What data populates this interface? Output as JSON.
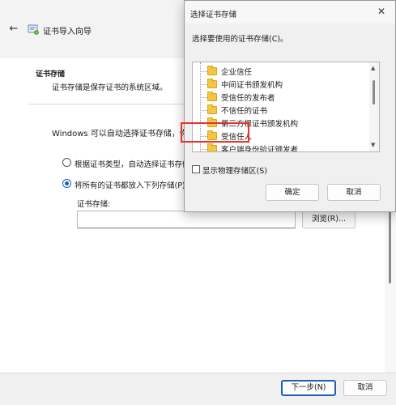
{
  "wizard": {
    "title": "证书导入向导",
    "back_icon": "back-arrow-icon",
    "app_icon": "certificate-icon",
    "heading": "证书存储",
    "description": "证书存储是保存证书的系统区域。",
    "auto_text": "Windows 可以自动选择证书存储，你也",
    "option_auto_label": "根据证书类型，自动选择证书存储",
    "option_manual_label": "将所有的证书都放入下列存储(P)",
    "store_label": "证书存储:",
    "store_value": "",
    "browse_label": "浏览(R)...",
    "next_label": "下一步(N)",
    "cancel_label": "取消"
  },
  "dialog": {
    "title": "选择证书存储",
    "close_icon": "close-icon",
    "prompt": "选择要使用的证书存储(C)。",
    "stores": [
      "企业信任",
      "中间证书颁发机构",
      "受信任的发布者",
      "不信任的证书",
      "第三方根证书颁发机构",
      "受信任人",
      "客户端身份验证颁发者"
    ],
    "highlighted_store": "受信任人",
    "show_physical_label": "显示物理存储区(S)",
    "show_physical_checked": false,
    "ok_label": "确定",
    "cancel_label": "取消"
  },
  "colors": {
    "accent": "#1c5fb8",
    "highlight_box": "#e5322d",
    "folder": "#f5c542"
  }
}
